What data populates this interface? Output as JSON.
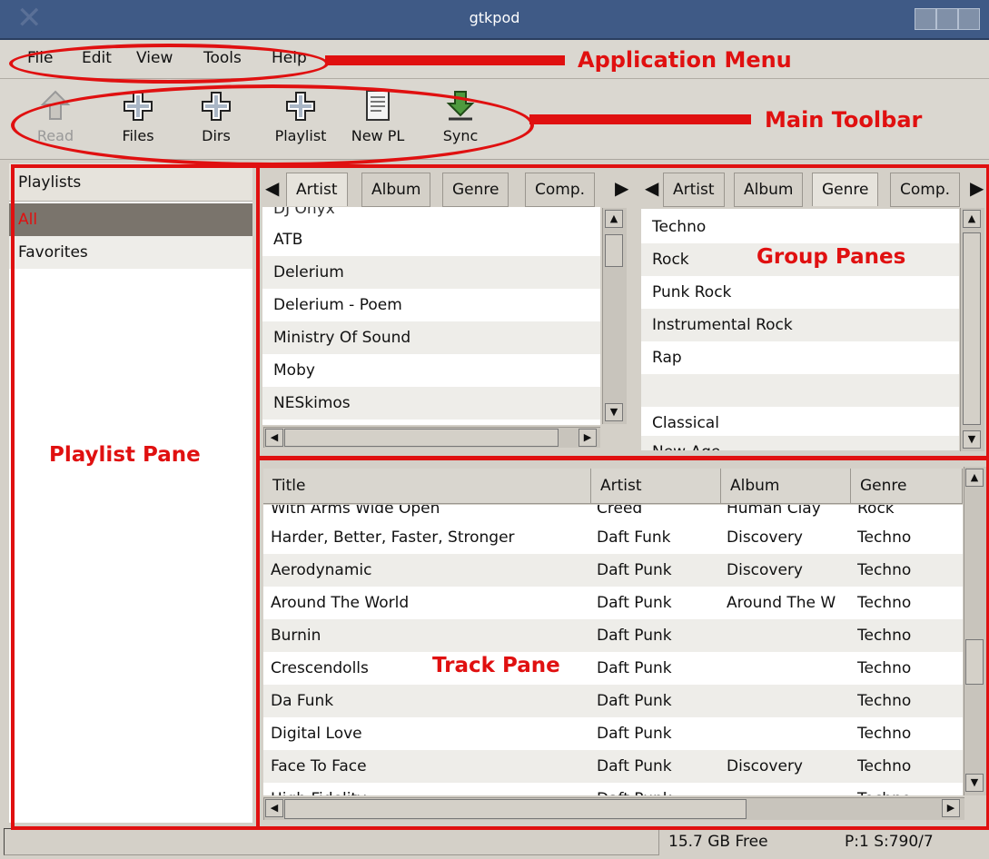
{
  "window": {
    "title": "gtkpod"
  },
  "menu": [
    "File",
    "Edit",
    "View",
    "Tools",
    "Help"
  ],
  "toolbar": [
    {
      "label": "Read",
      "icon": "read-icon",
      "disabled": true
    },
    {
      "label": "Files",
      "icon": "add-files-icon"
    },
    {
      "label": "Dirs",
      "icon": "add-dirs-icon"
    },
    {
      "label": "Playlist",
      "icon": "add-playlist-icon"
    },
    {
      "label": "New PL",
      "icon": "new-playlist-icon"
    },
    {
      "label": "Sync",
      "icon": "sync-icon"
    }
  ],
  "annotations": {
    "app_menu": "Application Menu",
    "main_toolbar": "Main Toolbar",
    "playlist_pane": "Playlist Pane",
    "group_panes": "Group Panes",
    "track_pane": "Track Pane"
  },
  "playlists": {
    "header": "Playlists",
    "items": [
      "All",
      "Favorites"
    ],
    "selected": "All"
  },
  "group_left": {
    "tabs": [
      "Artist",
      "Album",
      "Genre",
      "Comp."
    ],
    "active_tab": "Artist",
    "partial_top": "DJ Onyx",
    "items": [
      "ATB",
      "Delerium",
      "Delerium - Poem",
      "Ministry Of Sound",
      "Moby",
      "NESkimos"
    ]
  },
  "group_right": {
    "tabs": [
      "Artist",
      "Album",
      "Genre",
      "Comp."
    ],
    "active_tab": "Genre",
    "items": [
      "Techno",
      "Rock",
      "Punk Rock",
      "Instrumental Rock",
      "Rap",
      "",
      "Classical"
    ],
    "partial_bottom": "New Age"
  },
  "tracks": {
    "columns": [
      "Title",
      "Artist",
      "Album",
      "Genre"
    ],
    "partial_top": [
      "With Arms Wide Open",
      "Creed",
      "Human Clay",
      "Rock"
    ],
    "rows": [
      [
        "Harder, Better, Faster, Stronger",
        "Daft Funk",
        "Discovery",
        "Techno"
      ],
      [
        "Aerodynamic",
        "Daft Punk",
        "Discovery",
        "Techno"
      ],
      [
        "Around The World",
        "Daft Punk",
        "Around The W",
        "Techno"
      ],
      [
        "Burnin",
        "Daft Punk",
        "",
        "Techno"
      ],
      [
        "Crescendolls",
        "Daft Punk",
        "",
        "Techno"
      ],
      [
        "Da Funk",
        "Daft Punk",
        "",
        "Techno"
      ],
      [
        "Digital Love",
        "Daft Punk",
        "",
        "Techno"
      ],
      [
        "Face To Face",
        "Daft Punk",
        "Discovery",
        "Techno"
      ]
    ],
    "partial_bottom": [
      "High Fidelity",
      "Daft Punk",
      "",
      "Techno"
    ]
  },
  "status": {
    "free": "15.7 GB Free",
    "count": "P:1 S:790/7"
  },
  "colors": {
    "annotation": "#e01010",
    "titlebar": "#3f5a86",
    "selected_row": "#7a746c"
  }
}
